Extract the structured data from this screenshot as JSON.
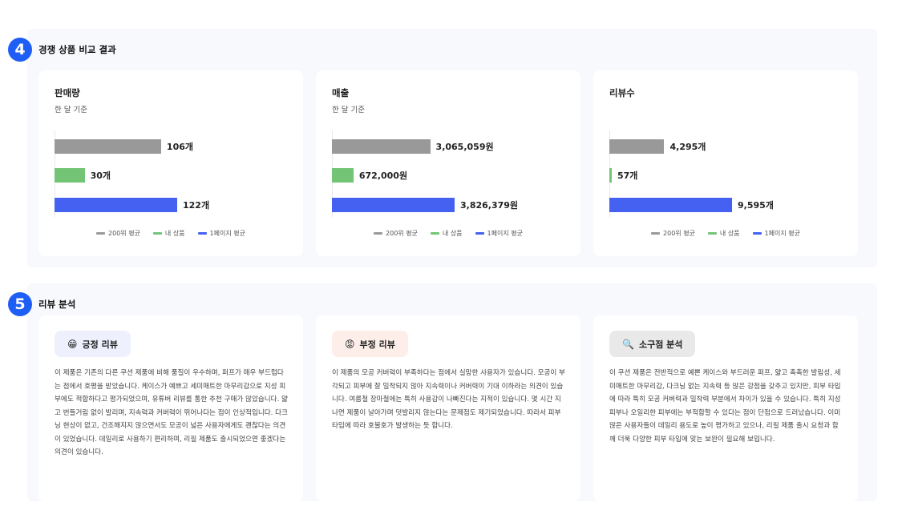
{
  "section4": {
    "number": "4",
    "title": "경쟁 상품 비교 결과",
    "legend": [
      {
        "label": "200위 평균",
        "color": "#999999"
      },
      {
        "label": "내 상품",
        "color": "#74c476"
      },
      {
        "label": "1페이지 평균",
        "color": "#4461f2"
      }
    ],
    "cards": [
      {
        "title": "판매량",
        "subtitle": "한 달 기준",
        "chart_data": {
          "type": "bar",
          "orientation": "horizontal",
          "title": "판매량",
          "categories": [
            "200위 평균",
            "내 상품",
            "1페이지 평균"
          ],
          "values": [
            106,
            30,
            122
          ],
          "value_labels": [
            "106개",
            "30개",
            "122개"
          ],
          "colors": [
            "#999999",
            "#74c476",
            "#4461f2"
          ],
          "xlim": [
            0,
            122
          ]
        }
      },
      {
        "title": "매출",
        "subtitle": "한 달 기준",
        "chart_data": {
          "type": "bar",
          "orientation": "horizontal",
          "title": "매출",
          "categories": [
            "200위 평균",
            "내 상품",
            "1페이지 평균"
          ],
          "values": [
            3065059,
            672000,
            3826379
          ],
          "value_labels": [
            "3,065,059원",
            "672,000원",
            "3,826,379원"
          ],
          "colors": [
            "#999999",
            "#74c476",
            "#4461f2"
          ],
          "xlim": [
            0,
            3826379
          ]
        }
      },
      {
        "title": "리뷰수",
        "subtitle": "",
        "chart_data": {
          "type": "bar",
          "orientation": "horizontal",
          "title": "리뷰수",
          "categories": [
            "200위 평균",
            "내 상품",
            "1페이지 평균"
          ],
          "values": [
            4295,
            57,
            9595
          ],
          "value_labels": [
            "4,295개",
            "57개",
            "9,595개"
          ],
          "colors": [
            "#999999",
            "#74c476",
            "#4461f2"
          ],
          "xlim": [
            0,
            9595
          ]
        }
      }
    ]
  },
  "section5": {
    "number": "5",
    "title": "리뷰 분석",
    "cards": [
      {
        "label": "긍정 리뷰",
        "icon": "grinning-face-icon",
        "pill_color": "#eef0fd",
        "text": "이 제품은 기존의 다른 쿠션 제품에 비해 품질이 우수하며, 퍼프가 매우 부드럽다는 점에서 호평을 받았습니다. 케이스가 예쁘고 세미매트한 마무리감으로 지성 피부에도 적합하다고 평가되었으며, 유튜버 리뷰를 통한 추천 구매가 많았습니다. 얇고 번들거림 없이 발리며, 지속력과 커버력이 뛰어나다는 점이 인상적입니다. 다크닝 현상이 없고, 건조해지지 않으면서도 모공이 넓은 사용자에게도 괜찮다는 의견이 있었습니다. 데일리로 사용하기 편리하며, 리필 제품도 출시되었으면 좋겠다는 의견이 있습니다."
      },
      {
        "label": "부정 리뷰",
        "icon": "angry-face-icon",
        "pill_color": "#fdeee9",
        "text": "이 제품의 모공 커버력이 부족하다는 점에서 실망한 사용자가 있습니다. 모공이 부각되고 피부에 잘 밀착되지 않아 지속력이나 커버력이 기대 이하라는 의견이 있습니다. 여름철 장마철에는 특히 사용감이 나빠진다는 지적이 있습니다. 몇 시간 지나면 제품이 날아가며 덧발리지 않는다는 문제점도 제기되었습니다. 따라서 피부 타입에 따라 호불호가 발생하는 듯 합니다."
      },
      {
        "label": "소구점 분석",
        "icon": "magnifier-icon",
        "pill_color": "#e9e9e9",
        "text": "이 쿠션 제품은 전반적으로 예쁜 케이스와 부드러운 퍼프, 얇고 촉촉한 발림성, 세미매트한 마무리감, 다크닝 없는 지속력 등 많은 강점을 갖추고 있지만, 피부 타입에 따라 특히 모공 커버력과 밀착력 부분에서 차이가 있을 수 있습니다. 특히 지성 피부나 오일리한 피부에는 부적합할 수 있다는 점이 단점으로 드러났습니다. 이미 많은 사용자들이 데일리 용도로 높이 평가하고 있으나, 리필 제품 출시 요청과 함께 더욱 다양한 피부 타입에 맞는 보완이 필요해 보입니다."
      }
    ]
  }
}
